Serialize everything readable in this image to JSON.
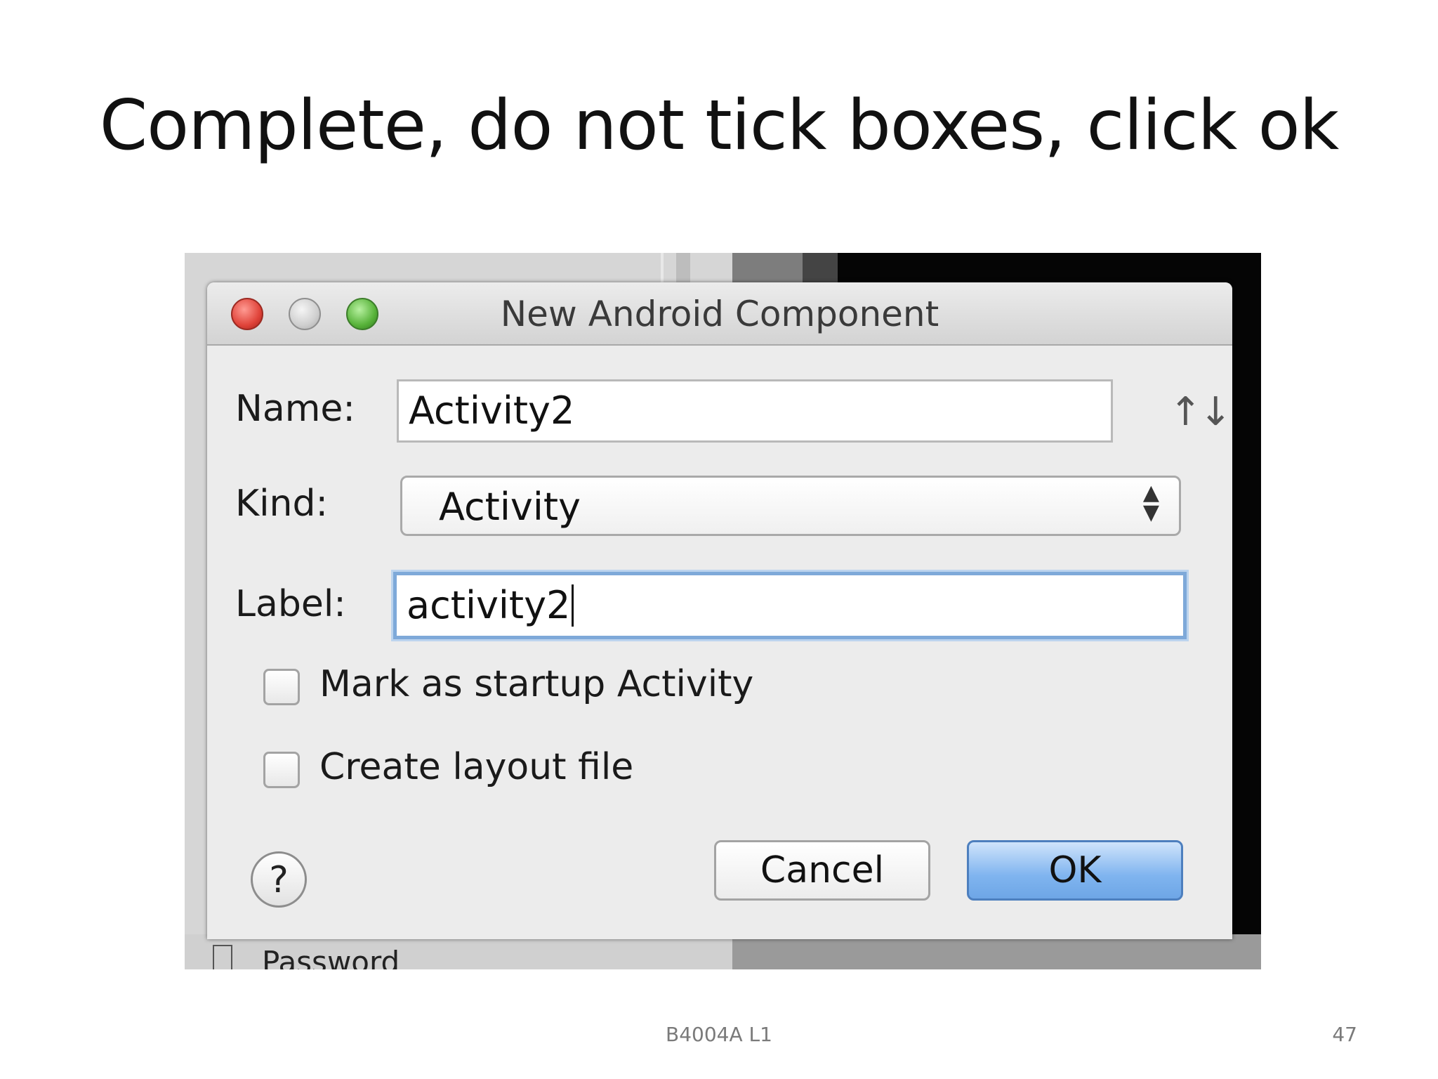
{
  "slide": {
    "title": "Complete, do not tick boxes, click ok",
    "footer_center": "B4004A L1",
    "page_number": "47"
  },
  "background": {
    "password_text": "Password"
  },
  "dialog": {
    "title": "New Android Component",
    "name_label": "Name:",
    "name_value": "Activity2",
    "kind_label": "Kind:",
    "kind_selected": "Activity",
    "label_label": "Label:",
    "label_value": "activity2",
    "checkboxes": [
      {
        "label": "Mark as startup Activity",
        "checked": false
      },
      {
        "label": "Create layout file",
        "checked": false
      }
    ],
    "help_symbol": "?",
    "cancel_label": "Cancel",
    "ok_label": "OK",
    "icons": {
      "sort": "↑↓",
      "select_arrows_up": "▲",
      "select_arrows_down": "▼"
    },
    "colors": {
      "ok_button": "#7fb4ef",
      "focus_ring": "#7ea9d9",
      "close_light": "#e0443a",
      "zoom_light": "#58b33a"
    }
  }
}
